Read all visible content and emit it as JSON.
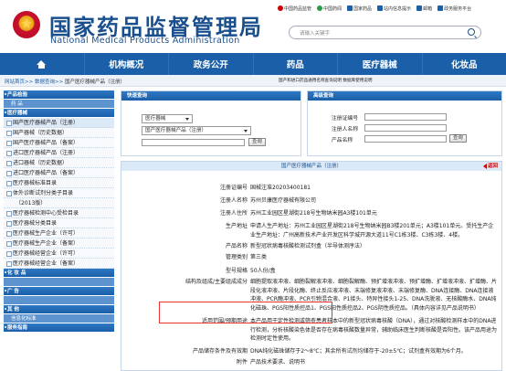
{
  "header": {
    "title_cn": "国家药品监督管理局",
    "title_en": "National Medical Products Administration",
    "top_links": [
      "中国药品监管",
      "中国药闻",
      "国家药品",
      "站内信息提示",
      "邮箱",
      "政务服务平台"
    ],
    "search_placeholder": "请输入关键字"
  },
  "nav": {
    "items": [
      "首页",
      "机构概况",
      "政务公开",
      "药品",
      "医疗器械",
      "化妆品"
    ]
  },
  "breadcrumb": {
    "path": "网站首页>> 数据查询>> ",
    "current": "国产医疗器械产品（注册）",
    "ticker": "国产和进口药品通用名称查询说明    数据库使用说明"
  },
  "sidebar": {
    "items": [
      {
        "kind": "head",
        "label": "产品检验"
      },
      {
        "kind": "sub",
        "label": "药  品"
      },
      {
        "kind": "head",
        "label": "医疗器械"
      },
      {
        "kind": "item",
        "label": "国产医疗器械产品（注册）",
        "active": true
      },
      {
        "kind": "item",
        "label": "国产器械（历史数据）"
      },
      {
        "kind": "item",
        "label": "国产医疗器械产品（备案）"
      },
      {
        "kind": "item",
        "label": "进口医疗器械产品（注册）"
      },
      {
        "kind": "item",
        "label": "进口器械（历史数据）"
      },
      {
        "kind": "item",
        "label": "进口医疗器械产品（备案）"
      },
      {
        "kind": "item",
        "label": "医疗器械标准目录"
      },
      {
        "kind": "item",
        "label": "体外诊断试剂分类子目录"
      },
      {
        "kind": "indent",
        "label": "（2013版）"
      },
      {
        "kind": "item",
        "label": "医疗器械检测中心受检目录"
      },
      {
        "kind": "item",
        "label": "医疗器械分类目录"
      },
      {
        "kind": "item",
        "label": "医疗器械生产企业（许可）"
      },
      {
        "kind": "item",
        "label": "医疗器械生产企业（备案）"
      },
      {
        "kind": "item",
        "label": "医疗器械经营企业（许可）"
      },
      {
        "kind": "item",
        "label": "医疗器械经营企业（备案）"
      },
      {
        "kind": "head",
        "label": "化 妆 品"
      },
      {
        "kind": "sub",
        "label": ""
      },
      {
        "kind": "head",
        "label": "广  告"
      },
      {
        "kind": "sub",
        "label": ""
      },
      {
        "kind": "head",
        "label": "其  他"
      },
      {
        "kind": "sub",
        "label": "信息化标准"
      },
      {
        "kind": "head",
        "label": "服务指南"
      }
    ]
  },
  "query_panel": {
    "title": "快速查询",
    "category": "医疗器械",
    "subcategory": "国产医疗器械产品（注册）",
    "search_btn": "查询"
  },
  "advanced_panel": {
    "title": "高级查询",
    "labels": [
      "注册证编号",
      "注册人名称",
      "产品名称"
    ],
    "search_btn": "查询"
  },
  "detail": {
    "title": "国产医疗器械产品（注册）",
    "back": "返回",
    "rows": [
      {
        "k": "注册证编号",
        "v": "国械注准20203400181"
      },
      {
        "k": "注册人名称",
        "v": "苏州贝康医疗器械有限公司"
      },
      {
        "k": "注册人住所",
        "v": "苏州工业园区星湖街218号生物纳米园A3楼101单元"
      },
      {
        "k": "生产地址",
        "v": "申请人生产地址：苏州工业园区星湖街218号生物纳米园B3楼201单元；A3楼101单元。受托生产企业生产地址：广州高新技术产业开发区科学城开源大道11号C1栋3楼、C3栋3楼、4楼。"
      },
      {
        "k": "产品名称",
        "v": "新型冠状病毒核酸检测试剂盒（半导体测序法）"
      },
      {
        "k": "管理类别",
        "v": "第三类"
      },
      {
        "k": "型号规格",
        "v": "50人份/盒"
      },
      {
        "k": "结构及组成/主要组成成分",
        "v": "细胞提取液冲液、细胞裂解液冲液、细胞裂解酶、预扩增液冲液、预扩增酶、扩增液冲液、扩增酶、片段化液冲液、片段化酶、终止反应液冲液、末端修复液冲液、末端修复酶、DNA连接酶、DNA连接液冲液、PCR酶冲液、PCR引物混合液、P1接头、特异性接头1-25、DNA洗脱液、无核酸酶水、DNA纯化磁珠、PGS阳性质控品1、PGS阳性质控品2、PGS阴性质控品。（具体内容详见产品说明书）"
      },
      {
        "k": "适用范围/预期用途",
        "v": "本产品用于定性检测或筛查患者样本中的新型冠状病毒核酸（DNA），通过对核酸检测样本中的DNA进行检测，分析核酸染色体是否存在病毒核酸数量异常，辅助临床医生判断核酸是否阳性。该产品用途为检测时定性使用。"
      },
      {
        "k": "产品储存条件及有效期",
        "v": "DNA纯化磁珠储存于2～8℃；其余所有试剂均储存于-20±5℃；试剂盒有效期为6个月。"
      },
      {
        "k": "附件",
        "v": "产品技术要求、说明书"
      }
    ]
  }
}
